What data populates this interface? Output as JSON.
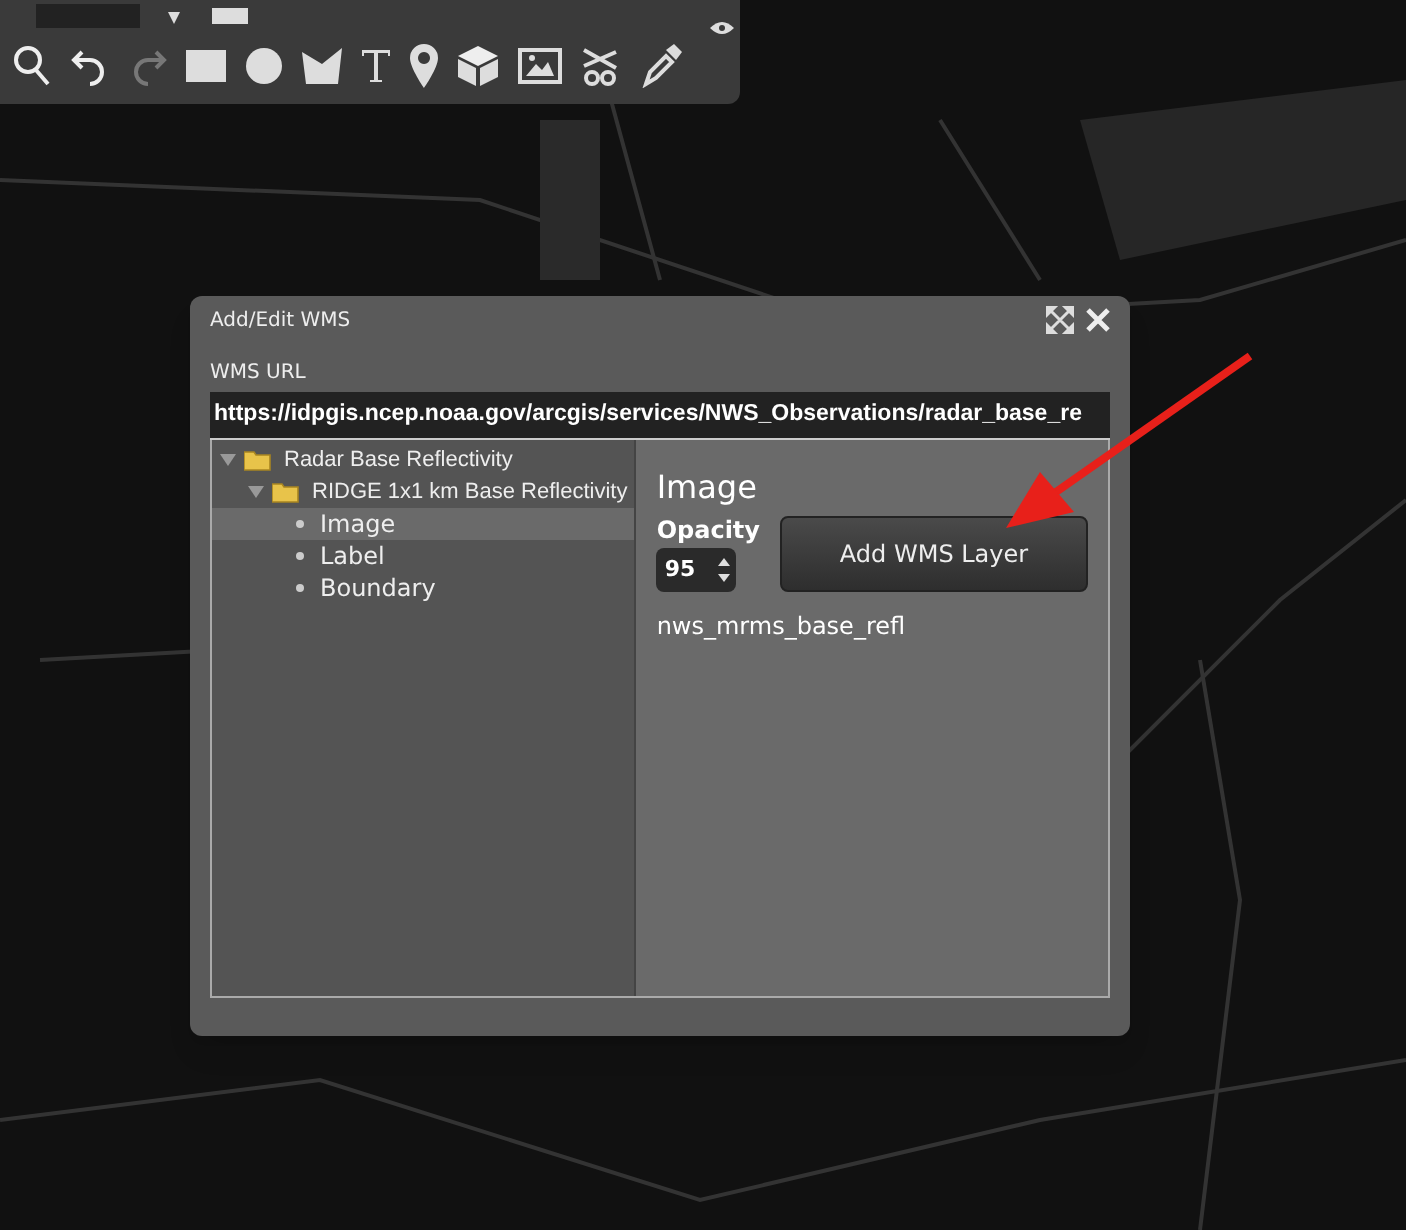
{
  "dialog": {
    "title": "Add/Edit WMS",
    "url_label": "WMS URL",
    "url_value": "https://idpgis.ncep.noaa.gov/arcgis/services/NWS_Observations/radar_base_re",
    "tree": [
      {
        "label": "Radar Base Reflectivity",
        "expanded": true,
        "children": [
          {
            "label": "RIDGE 1x1 km Base Reflectivity",
            "expanded": true,
            "children": [
              {
                "label": "Image",
                "selected": true
              },
              {
                "label": "Label",
                "selected": false
              },
              {
                "label": "Boundary",
                "selected": false
              }
            ]
          }
        ]
      }
    ],
    "detail": {
      "heading": "Image",
      "opacity_label": "Opacity",
      "opacity_value": "95",
      "button": "Add WMS Layer",
      "layer_name": "nws_mrms_base_refl"
    }
  }
}
